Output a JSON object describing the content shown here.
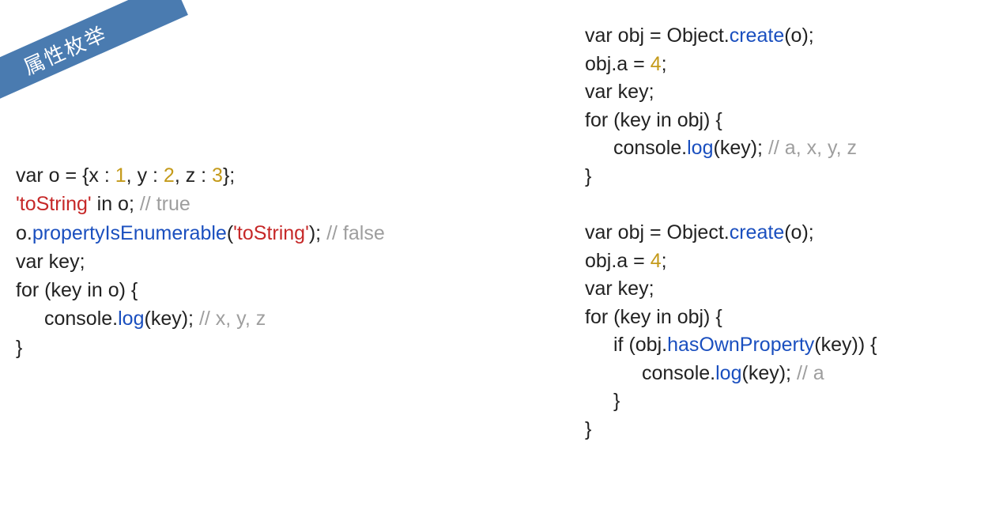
{
  "ribbon": {
    "title": "属性枚举"
  },
  "left": {
    "l1_a": "var o = {x : ",
    "l1_n1": "1",
    "l1_b": ", y : ",
    "l1_n2": "2",
    "l1_c": ", z : ",
    "l1_n3": "3",
    "l1_d": "};",
    "l2_s": "'toString'",
    "l2_a": " in o; ",
    "l2_c": "// true",
    "l3_a": "o.",
    "l3_m": "propertyIsEnumerable",
    "l3_b": "(",
    "l3_s": "'toString'",
    "l3_c": "); ",
    "l3_cm": "// false",
    "l4": "var key;",
    "l5": "for (key in o) {",
    "l6_a": "console.",
    "l6_m": "log",
    "l6_b": "(key); ",
    "l6_c": "// x, y, z",
    "l7": "}"
  },
  "right": {
    "b1_l1_a": "var obj = Object.",
    "b1_l1_m": "create",
    "b1_l1_b": "(o);",
    "b1_l2_a": "obj.a = ",
    "b1_l2_n": "4",
    "b1_l2_b": ";",
    "b1_l3": "var key;",
    "b1_l4": "for (key in obj) {",
    "b1_l5_a": "console.",
    "b1_l5_m": "log",
    "b1_l5_b": "(key); ",
    "b1_l5_c": "// a, x, y, z",
    "b1_l6": "}",
    "b2_l1_a": "var obj = Object.",
    "b2_l1_m": "create",
    "b2_l1_b": "(o);",
    "b2_l2_a": "obj.a = ",
    "b2_l2_n": "4",
    "b2_l2_b": ";",
    "b2_l3": "var key;",
    "b2_l4": "for (key in obj) {",
    "b2_l5_a": "if (obj.",
    "b2_l5_m": "hasOwnProperty",
    "b2_l5_b": "(key)) {",
    "b2_l6_a": "console.",
    "b2_l6_m": "log",
    "b2_l6_b": "(key); ",
    "b2_l6_c": "// a",
    "b2_l7": "}",
    "b2_l8": "}"
  }
}
